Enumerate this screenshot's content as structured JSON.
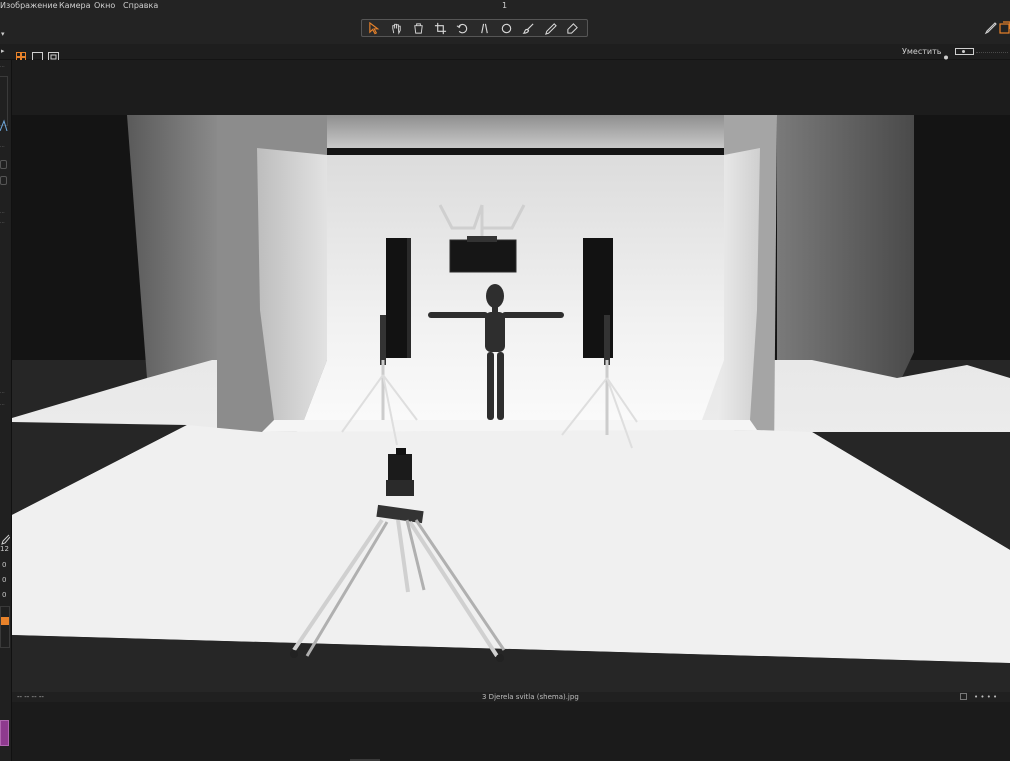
{
  "menu": {
    "items": [
      "Изображение",
      "Камера",
      "Окно",
      "Справка"
    ],
    "page_indicator": "1"
  },
  "toolbar": {
    "tools": [
      "select-tool-icon",
      "pan-tool-icon",
      "bucket-tool-icon",
      "crop-tool-icon",
      "rotate-tool-icon",
      "straighten-tool-icon",
      "circle-tool-icon",
      "brush-tool-icon",
      "pen-tool-icon",
      "eraser-tool-icon"
    ],
    "accent_color": "#e8822a"
  },
  "viewstrip": {
    "fit_label": "Уместить"
  },
  "leftpanel": {
    "values": [
      "12",
      "0",
      "0",
      "0"
    ]
  },
  "status": {
    "left": "-- -- -- --",
    "filename": "3 Djerela svitla (shema).jpg",
    "right": "• • • •"
  }
}
